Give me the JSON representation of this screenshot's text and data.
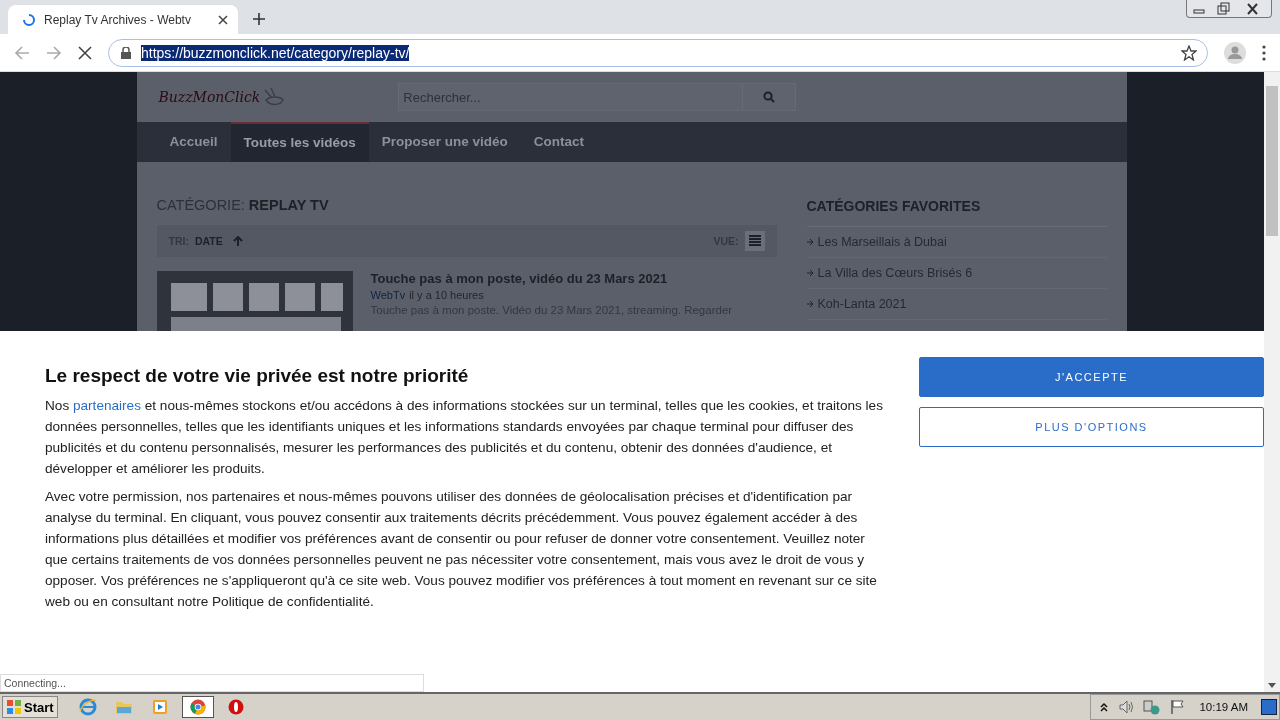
{
  "browser": {
    "tab": {
      "title": "Replay Tv Archives - Webtv",
      "loading": true
    },
    "url": "https://buzzmonclick.net/category/replay-tv/",
    "url_selected": true,
    "status": "Connecting..."
  },
  "site": {
    "logo": "BuzzMonClick",
    "search": {
      "placeholder": "Rechercher..."
    },
    "nav": [
      {
        "label": "Accueil",
        "selected": false
      },
      {
        "label": "Toutes les vidéos",
        "selected": true
      },
      {
        "label": "Proposer une vidéo",
        "selected": false
      },
      {
        "label": "Contact",
        "selected": false
      }
    ],
    "category_label": "CATÉGORIE:",
    "category_name": "REPLAY TV",
    "sort_label": "TRI:",
    "sort_value": "DATE",
    "view_label": "VUE:",
    "article": {
      "title": "Touche pas à mon poste, vidéo du 23 Mars 2021",
      "source": "WebTv",
      "time": "il y a 10 heures",
      "excerpt": "Touche pas à mon poste. Vidéo du 23 Mars 2021, streaming. Regarder"
    },
    "sidebar": {
      "title": "CATÉGORIES FAVORITES",
      "items": [
        "Les Marseillais à Dubai",
        "La Villa des Cœurs Brisés 6",
        "Koh-Lanta 2021"
      ]
    }
  },
  "consent": {
    "title": "Le respect de votre vie privée est notre priorité",
    "intro": {
      "before": "Nos ",
      "link": "partenaires",
      "after": " et nous-mêmes stockons et/ou accédons à des informations stockées sur un terminal, telles que les cookies, et traitons les données personnelles, telles que les identifiants uniques et les informations standards envoyées par chaque terminal pour diffuser des publicités et du contenu personnalisés, mesurer les performances des publicités et du contenu, obtenir des données d'audience, et développer et améliorer les produits."
    },
    "body": "Avec votre permission, nos partenaires et nous-mêmes pouvons utiliser des données de géolocalisation précises et d'identification par analyse du terminal. En cliquant, vous pouvez consentir aux traitements décrits précédemment. Vous pouvez également accéder à des informations plus détaillées et modifier vos préférences avant de consentir ou pour refuser de donner votre consentement. Veuillez noter que certains traitements de vos données personnelles peuvent ne pas nécessiter votre consentement, mais vous avez le droit de vous y opposer. Vos préférences ne s'appliqueront qu'à ce site web. Vous pouvez modifier vos préférences à tout moment en revenant sur ce site web ou en consultant notre Politique de confidentialité.",
    "buttons": [
      {
        "label": "J'ACCEPTE",
        "kind": "primary"
      },
      {
        "label": "PLUS D'OPTIONS",
        "kind": "secondary"
      }
    ]
  },
  "taskbar": {
    "start": "Start",
    "apps": [
      {
        "kind": "ie",
        "active": false
      },
      {
        "kind": "folder",
        "active": false
      },
      {
        "kind": "media",
        "active": false
      },
      {
        "kind": "chrome",
        "active": true
      },
      {
        "kind": "stop",
        "active": false
      }
    ],
    "clock": "10:19 AM"
  }
}
